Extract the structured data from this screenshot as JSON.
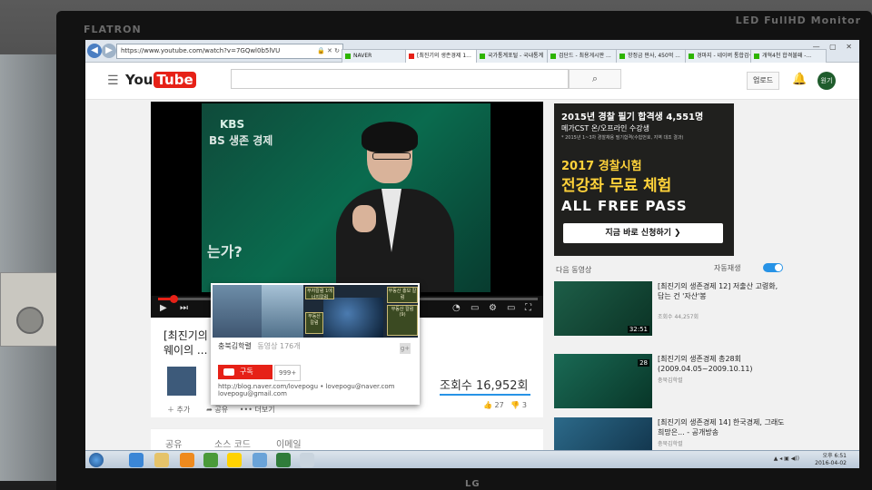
{
  "monitor": {
    "brand_left": "FLATRON",
    "brand_right": "LED FullHD Monitor",
    "brand_bottom": "LG"
  },
  "browser": {
    "address": "https://www.youtube.com/watch?v=7GQwl0b5lVU",
    "tabs": [
      {
        "label": "NAVER"
      },
      {
        "label": "[최진기의 생존경제 1..."
      },
      {
        "label": "국가통계포털 - 국내통계"
      },
      {
        "label": "검단드 - 최용게시판 ..."
      },
      {
        "label": "항정금 판사, 450억 ..."
      },
      {
        "label": "경마지 - 네이버 통합검색"
      },
      {
        "label": "개혁4천 합격불패 -..."
      }
    ]
  },
  "header": {
    "logo_you": "You",
    "logo_tube": "Tube",
    "search_icon": "search-icon",
    "upload_label": "업로드",
    "avatar_label": "원기"
  },
  "video": {
    "overlay_kbs": "KBS",
    "overlay_title": "BS 생존 경제",
    "overlay_q": "는가?",
    "title": "[최진기의 생존경제 11] ...르",
    "title_line2": "웨이의 ...",
    "views": "조회수 16,952회",
    "likes": "27",
    "dislikes": "3",
    "progress_fraction": 0.04,
    "action_add": "추가",
    "action_share": "공유",
    "action_more": "더보기"
  },
  "share_tabs": {
    "share": "공유",
    "embed": "소스 코드",
    "email": "이메일"
  },
  "hovercard": {
    "channel": "충북김학렬",
    "channel_views": "동영상 176개",
    "subscribe": "구독",
    "sub_count": "999+",
    "link": "http://blog.naver.com/lovepogu • lovepogu@naver.com",
    "email": "lovepogu@gmail.com",
    "box1": "부자칼럼 1에너지칼럼",
    "box2": "부동산 칼럼",
    "box3": "부동산 홍보 칼럼",
    "box4": "부동산 칼럼 (9)"
  },
  "ad": {
    "line1": "2015년 경찰 필기 합격생 4,551명",
    "line2": "메가CST 온/오프라인 수강생",
    "line3": "* 2015년 1~3차 경찰채용 필기합격(수험번호, 지역 대조 결과)",
    "line4": "2017 경찰시험",
    "line5": "전강좌 무료 체험",
    "line6": "ALL FREE PASS",
    "button": "지금 바로 신청하기 ❯"
  },
  "sidebar": {
    "next_label": "다음 동영상",
    "autoplay_label": "자동재생",
    "recs": [
      {
        "title": "[최진기의 생존경제 12] 저출산 고령화, 답는 건 '자산'봉",
        "meta": "조회수 44,257회",
        "duration": "32:51"
      },
      {
        "title": "[최진기의 생존경제 총28회 (2009.04.05~2009.10.11)",
        "meta": "충북김학렬",
        "duration": "28"
      },
      {
        "title": "[최진기의 생존경제 14] 한국경제, 그래도 희망은... - 공개방송",
        "meta": "충북김학렬",
        "duration": ""
      }
    ]
  },
  "taskbar": {
    "time": "오후 6:51",
    "date": "2016-04-02"
  },
  "colors": {
    "brand_red": "#e62117",
    "accent_blue": "#2793e6",
    "ad_yellow": "#ffd23a"
  }
}
